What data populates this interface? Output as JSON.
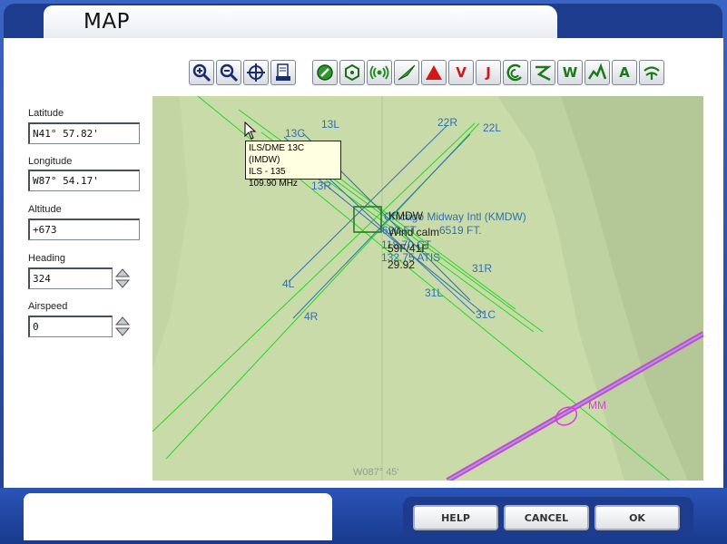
{
  "window": {
    "title": "MAP"
  },
  "toolbar": {
    "buttons": [
      {
        "id": "zoom-in",
        "icon": "zoom-in-icon"
      },
      {
        "id": "zoom-out",
        "icon": "zoom-out-icon"
      },
      {
        "id": "center",
        "icon": "center-aircraft-icon"
      },
      {
        "id": "print",
        "icon": "print-icon"
      },
      {
        "id": "airports",
        "icon": "airport-icon"
      },
      {
        "id": "vor",
        "icon": "vor-icon"
      },
      {
        "id": "ndb",
        "icon": "ndb-icon"
      },
      {
        "id": "ils",
        "icon": "ils-icon"
      },
      {
        "id": "intersections",
        "icon": "intersection-icon",
        "label": ""
      },
      {
        "id": "victor",
        "label": "V"
      },
      {
        "id": "jet",
        "label": "J"
      },
      {
        "id": "approach",
        "icon": "approach-icon"
      },
      {
        "id": "airways",
        "icon": "airway-icon"
      },
      {
        "id": "weather",
        "label": "W"
      },
      {
        "id": "terrain",
        "icon": "terrain-icon"
      },
      {
        "id": "altitude",
        "label": "A"
      },
      {
        "id": "wind",
        "icon": "wind-icon"
      }
    ]
  },
  "fields": {
    "latitude": {
      "label": "Latitude",
      "value": "N41° 57.82'"
    },
    "longitude": {
      "label": "Longitude",
      "value": "W87° 54.17'"
    },
    "altitude": {
      "label": "Altitude",
      "value": "+673"
    },
    "heading": {
      "label": "Heading",
      "value": "324"
    },
    "airspeed": {
      "label": "Airspeed",
      "value": "0"
    }
  },
  "map": {
    "runways": [
      "13L",
      "13C",
      "13R",
      "22R",
      "22L",
      "4L",
      "4R",
      "31R",
      "31L",
      "31C"
    ],
    "airport_name": "Chicago Midway Intl (KMDW)",
    "airport_code": "KMDW",
    "elevation": "620 FT.",
    "runway_length": "6519 FT.",
    "wind": "Wind calm",
    "temperature": "59F/41F",
    "pressure": "29.92",
    "ct_freq": "118.70 CT",
    "atis_freq": "132.75 ATIS",
    "marker": "MM",
    "longitude_label": "W087° 45'",
    "tooltip": {
      "line1": "ILS/DME 13C (IMDW)",
      "line2": "ILS - 135",
      "line3": "109.90 MHz"
    },
    "colors": {
      "background": "#c9dba9",
      "runway_line": "#2e6fb5",
      "ils_line": "#23d823",
      "airway": "#d640d6"
    }
  },
  "buttons": {
    "help": "HELP",
    "cancel": "CANCEL",
    "ok": "OK"
  }
}
